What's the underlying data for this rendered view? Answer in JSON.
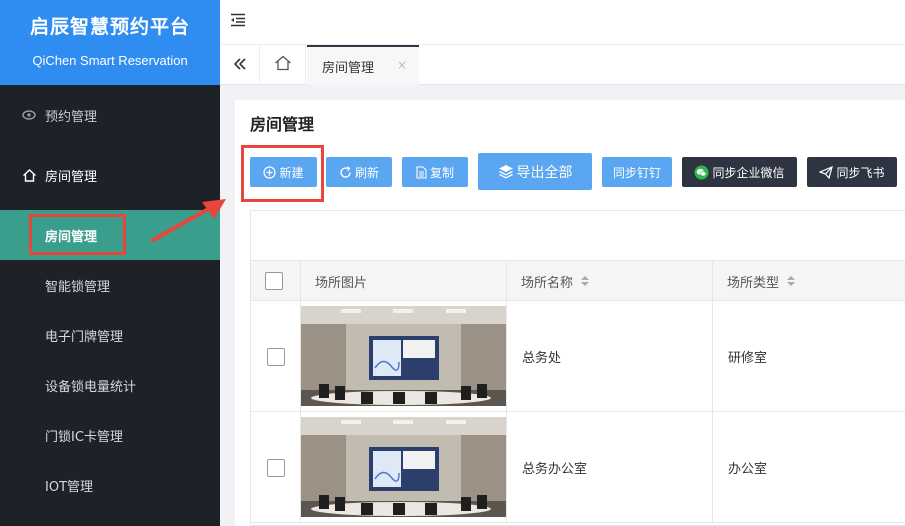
{
  "brand": {
    "title": "启辰智慧预约平台",
    "subtitle": "QiChen Smart Reservation"
  },
  "sidebar": {
    "groups": [
      {
        "label": "预约管理",
        "icon": "eye-icon"
      },
      {
        "label": "房间管理",
        "icon": "home-icon"
      }
    ],
    "items": [
      {
        "label": "房间管理",
        "active": true
      },
      {
        "label": "智能锁管理"
      },
      {
        "label": "电子门牌管理"
      },
      {
        "label": "设备锁电量统计"
      },
      {
        "label": "门锁IC卡管理"
      },
      {
        "label": "IOT管理"
      }
    ]
  },
  "tabs": {
    "current": "房间管理",
    "close": "×"
  },
  "page": {
    "title": "房间管理"
  },
  "toolbar": {
    "new": "新建",
    "refresh": "刷新",
    "copy": "复制",
    "export_all": "导出全部",
    "sync_dingtalk": "同步钉钉",
    "sync_wecom": "同步企业微信",
    "sync_feishu": "同步飞书"
  },
  "table": {
    "columns": [
      "场所图片",
      "场所名称",
      "场所类型"
    ],
    "rows": [
      {
        "name": "总务处",
        "type": "研修室"
      },
      {
        "name": "总务办公室",
        "type": "办公室"
      }
    ]
  },
  "colors": {
    "brand": "#2f8cf0",
    "sidebar": "#1f2129",
    "active": "#3a9e8c",
    "primary_button": "#5aa6f0",
    "dark_button": "#2f3443",
    "annotation": "#e8453c"
  }
}
